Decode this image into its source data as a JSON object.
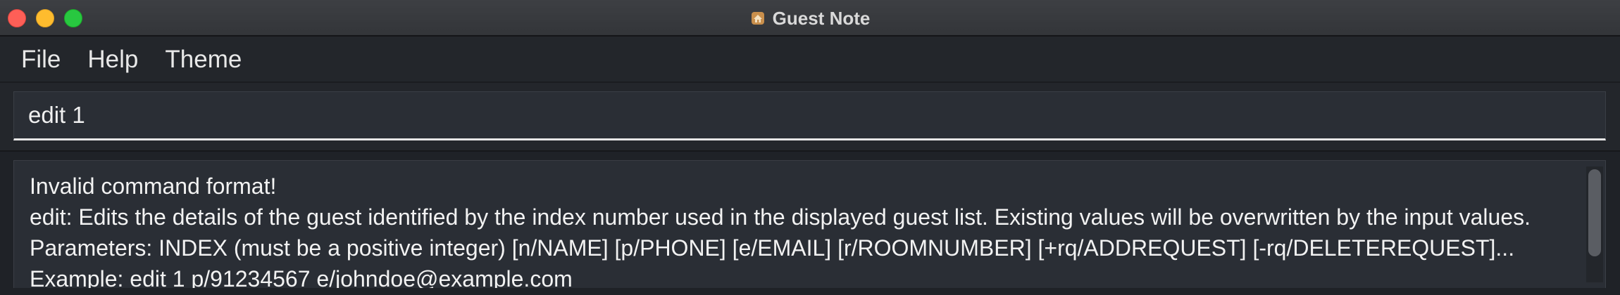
{
  "window": {
    "title": "Guest Note",
    "app_icon": "house-icon",
    "controls": [
      "close",
      "minimize",
      "maximize"
    ]
  },
  "menu": {
    "items": [
      {
        "label": "File"
      },
      {
        "label": "Help"
      },
      {
        "label": "Theme"
      }
    ]
  },
  "command": {
    "value": "edit 1",
    "placeholder": ""
  },
  "result": {
    "lines": [
      "Invalid command format!",
      "edit: Edits the details of the guest identified by the index number used in the displayed guest list. Existing values will be overwritten by the input values.",
      "Parameters: INDEX (must be a positive integer) [n/NAME] [p/PHONE] [e/EMAIL] [r/ROOMNUMBER] [+rq/ADDREQUEST] [-rq/DELETEREQUEST]...",
      "Example: edit 1 p/91234567 e/johndoe@example.com"
    ]
  },
  "colors": {
    "background": "#23262b",
    "panel": "#2a2e35",
    "text": "#f2f2f2",
    "close": "#fe5f57",
    "minimize": "#febc2e",
    "maximize": "#28c840"
  }
}
